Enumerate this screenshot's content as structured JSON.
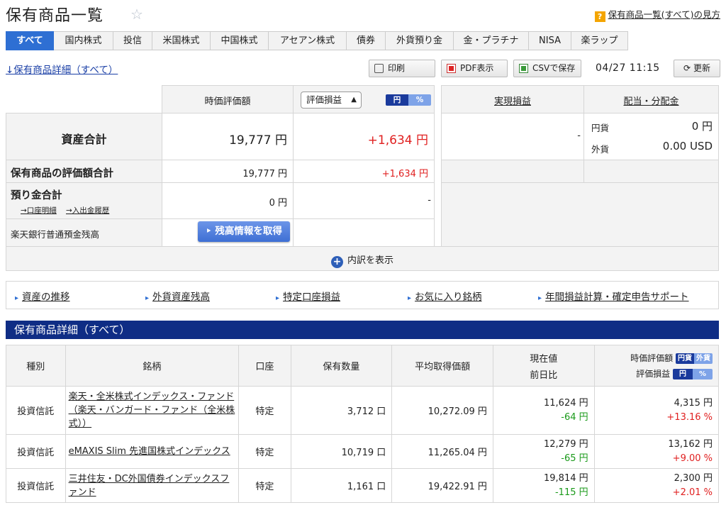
{
  "header": {
    "title": "保有商品一覧",
    "help_icon": "?",
    "help_link": "保有商品一覧(すべて)の見方"
  },
  "tabs": [
    {
      "label": "すべて",
      "active": true
    },
    {
      "label": "国内株式"
    },
    {
      "label": "投信"
    },
    {
      "label": "米国株式"
    },
    {
      "label": "中国株式"
    },
    {
      "label": "アセアン株式"
    },
    {
      "label": "債券"
    },
    {
      "label": "外貨預り金"
    },
    {
      "label": "金・プラチナ"
    },
    {
      "label": "NISA"
    },
    {
      "label": "楽ラップ"
    }
  ],
  "toolbar": {
    "detail_link": "↓保有商品詳細（すべて）",
    "print": "印刷",
    "pdf": "PDF表示",
    "csv": "CSVで保存",
    "timestamp": "04/27 11:15",
    "refresh": "更新"
  },
  "summary": {
    "col_valuation": "時価評価額",
    "select_value": "評価損益",
    "toggle_yen": "円",
    "toggle_pct": "%",
    "col_realized": "実現損益",
    "col_dividend": "配当・分配金",
    "total_label": "資産合計",
    "total_value": "19,777 円",
    "total_pl": "+1,634 円",
    "total_realized": "-",
    "div_yen_label": "円貨",
    "div_yen_value": "0 円",
    "div_fx_label": "外貨",
    "div_fx_value": "0.00 USD",
    "holdings_label": "保有商品の評価額合計",
    "holdings_value": "19,777 円",
    "holdings_pl": "+1,634 円",
    "deposit_label": "預り金合計",
    "deposit_link1": "→口座明細",
    "deposit_link2": "→入出金履歴",
    "deposit_value": "0 円",
    "deposit_pl": "-",
    "bank_label": "楽天銀行普通預金残高",
    "bank_button": "残高情報を取得",
    "breakdown": "内訳を表示"
  },
  "quick_links": [
    "資産の推移",
    "外貨資産残高",
    "特定口座損益",
    "お気に入り銘柄",
    "年間損益計算・確定申告サポート"
  ],
  "section_title": "保有商品詳細（すべて）",
  "table": {
    "headers": {
      "type": "種別",
      "name": "銘柄",
      "account": "口座",
      "qty": "保有数量",
      "avg": "平均取得価額",
      "price1": "現在値",
      "price2": "前日比",
      "val1": "時価評価額",
      "val2": "評価損益",
      "tog_a": "円貨",
      "tog_b": "外貨",
      "tog_c": "円",
      "tog_d": "%"
    },
    "rows": [
      {
        "type": "投資信託",
        "name": "楽天・全米株式インデックス・ファンド（楽天・バンガード・ファンド（全米株式））",
        "account": "特定",
        "qty": "3,712 口",
        "avg": "10,272.09 円",
        "price": "11,624 円",
        "change": "-64 円",
        "value": "4,315 円",
        "pl": "+13.16 %"
      },
      {
        "type": "投資信託",
        "name": "eMAXIS Slim 先進国株式インデックス",
        "account": "特定",
        "qty": "10,719 口",
        "avg": "11,265.04 円",
        "price": "12,279 円",
        "change": "-65 円",
        "value": "13,162 円",
        "pl": "+9.00 %"
      },
      {
        "type": "投資信託",
        "name": "三井住友・DC外国債券インデックスファンド",
        "account": "特定",
        "qty": "1,161 口",
        "avg": "19,422.91 円",
        "price": "19,814 円",
        "change": "-115 円",
        "value": "2,300 円",
        "pl": "+2.01 %"
      }
    ]
  },
  "colors": {
    "accent": "#2e6fd3",
    "section_bar": "#0f2d85",
    "positive": "#e02020",
    "negative": "#1a9a1a"
  }
}
